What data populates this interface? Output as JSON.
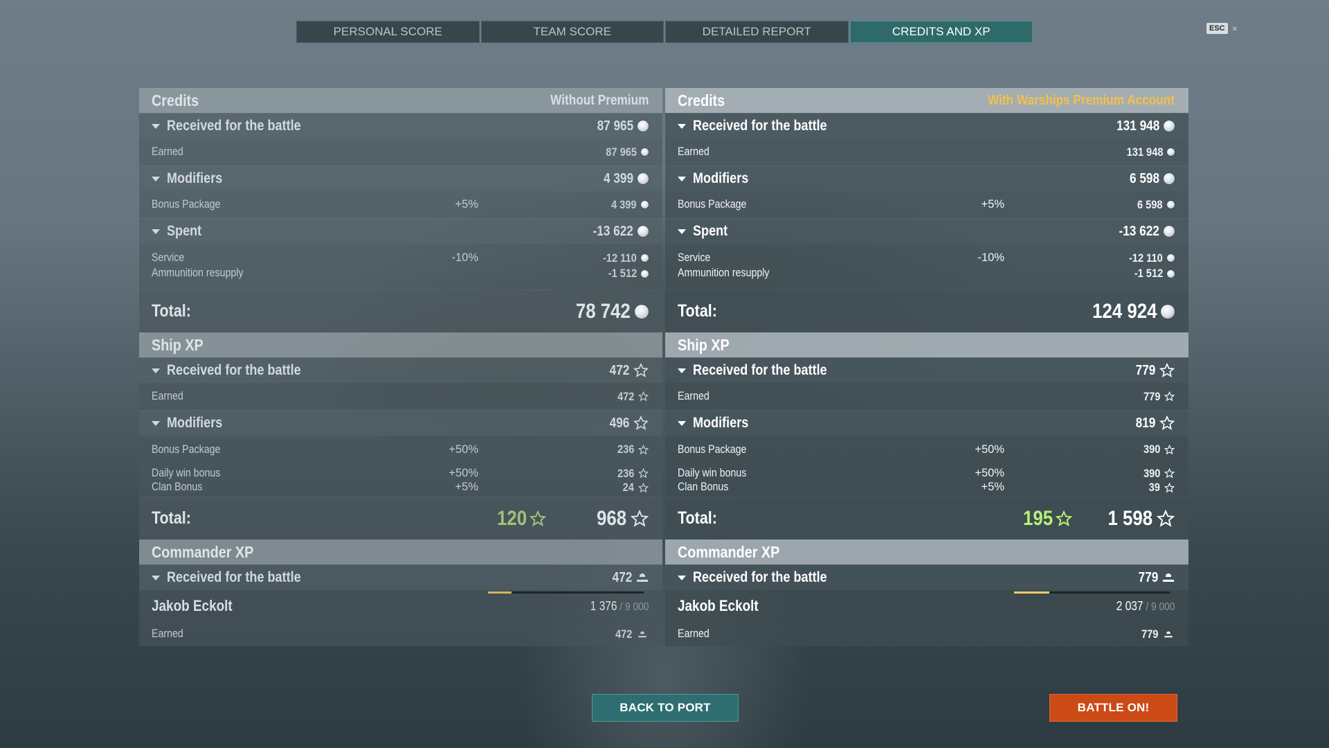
{
  "tabs": [
    {
      "label": "PERSONAL SCORE",
      "active": false
    },
    {
      "label": "TEAM SCORE",
      "active": false
    },
    {
      "label": "DETAILED REPORT",
      "active": false
    },
    {
      "label": "CREDITS AND XP",
      "active": true
    }
  ],
  "esc": {
    "key": "ESC",
    "close": "×"
  },
  "left": {
    "credits": {
      "title": "Credits",
      "note": "Without Premium",
      "received": {
        "label": "Received for the battle",
        "value": "87 965"
      },
      "earned": {
        "label": "Earned",
        "value": "87 965"
      },
      "modifiers": {
        "label": "Modifiers",
        "value": "4 399"
      },
      "bonus_package": {
        "label": "Bonus Package",
        "pct": "+5%",
        "value": "4 399"
      },
      "spent": {
        "label": "Spent",
        "value": "-13 622"
      },
      "service": {
        "label": "Service",
        "pct": "-10%",
        "value": "-12 110"
      },
      "ammo": {
        "label": "Ammunition resupply",
        "value": "-1 512"
      },
      "total": {
        "label": "Total:",
        "value": "78 742"
      }
    },
    "ship_xp": {
      "title": "Ship XP",
      "received": {
        "label": "Received for the battle",
        "value": "472"
      },
      "earned": {
        "label": "Earned",
        "value": "472"
      },
      "modifiers": {
        "label": "Modifiers",
        "value": "496"
      },
      "bonus_package": {
        "label": "Bonus Package",
        "pct": "+50%",
        "value": "236"
      },
      "daily_win": {
        "label": "Daily win bonus",
        "pct": "+50%",
        "value": "236"
      },
      "clan_bonus": {
        "label": "Clan Bonus",
        "pct": "+5%",
        "value": "24"
      },
      "total": {
        "label": "Total:",
        "bonus": "120",
        "value": "968"
      }
    },
    "commander_xp": {
      "title": "Commander XP",
      "received": {
        "label": "Received for the battle",
        "value": "472"
      },
      "commander": {
        "name": "Jakob Eckolt",
        "xp": "1 376",
        "max": " / 9 000",
        "progress": 0.153
      },
      "earned": {
        "label": "Earned",
        "value": "472"
      }
    }
  },
  "right": {
    "credits": {
      "title": "Credits",
      "note": "With Warships Premium Account",
      "received": {
        "label": "Received for the battle",
        "value": "131 948"
      },
      "earned": {
        "label": "Earned",
        "value": "131 948"
      },
      "modifiers": {
        "label": "Modifiers",
        "value": "6 598"
      },
      "bonus_package": {
        "label": "Bonus Package",
        "pct": "+5%",
        "value": "6 598"
      },
      "spent": {
        "label": "Spent",
        "value": "-13 622"
      },
      "service": {
        "label": "Service",
        "pct": "-10%",
        "value": "-12 110"
      },
      "ammo": {
        "label": "Ammunition resupply",
        "value": "-1 512"
      },
      "total": {
        "label": "Total:",
        "value": "124 924"
      }
    },
    "ship_xp": {
      "title": "Ship XP",
      "received": {
        "label": "Received for the battle",
        "value": "779"
      },
      "earned": {
        "label": "Earned",
        "value": "779"
      },
      "modifiers": {
        "label": "Modifiers",
        "value": "819"
      },
      "bonus_package": {
        "label": "Bonus Package",
        "pct": "+50%",
        "value": "390"
      },
      "daily_win": {
        "label": "Daily win bonus",
        "pct": "+50%",
        "value": "390"
      },
      "clan_bonus": {
        "label": "Clan Bonus",
        "pct": "+5%",
        "value": "39"
      },
      "total": {
        "label": "Total:",
        "bonus": "195",
        "value": "1 598"
      }
    },
    "commander_xp": {
      "title": "Commander XP",
      "received": {
        "label": "Received for the battle",
        "value": "779"
      },
      "commander": {
        "name": "Jakob Eckolt",
        "xp": "2 037",
        "max": " / 9 000",
        "progress": 0.226
      },
      "earned": {
        "label": "Earned",
        "value": "779"
      }
    }
  },
  "buttons": {
    "back_to_port": "BACK TO PORT",
    "battle_on": "BATTLE ON!"
  },
  "colors": {
    "accent_teal": "#2f6a6a",
    "premium_gold": "#f3c14a",
    "battle_orange": "#cc4a16",
    "bonus_green": "#b7f07a"
  },
  "icons": {
    "credits": "credit-coin-icon",
    "xp": "xp-star-icon",
    "commander_xp": "commander-cap-icon"
  }
}
